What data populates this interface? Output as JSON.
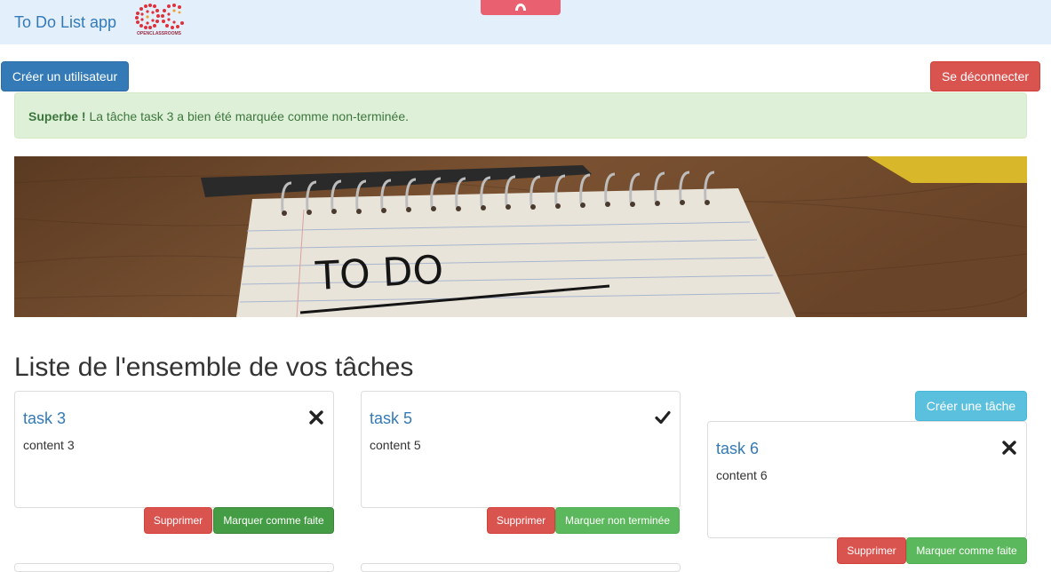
{
  "app": {
    "brand": "To Do List app",
    "logo_text": "OPENCLASSROOMS"
  },
  "toolbar": {
    "create_user": "Créer un utilisateur",
    "logout": "Se déconnecter"
  },
  "alert": {
    "strong": "Superbe !",
    "message": " La tâche task 3 a bien été marquée comme non-terminée."
  },
  "banner": {
    "text": "TO DO"
  },
  "main": {
    "heading": "Liste de l'ensemble de vos tâches",
    "create_task": "Créer une tâche"
  },
  "tasks": [
    {
      "title": "task 3",
      "content": "content 3",
      "status_icon": "cross-icon",
      "delete": "Supprimer",
      "toggle": "Marquer comme faite"
    },
    {
      "title": "task 5",
      "content": "content 5",
      "status_icon": "check-icon",
      "delete": "Supprimer",
      "toggle": "Marquer non terminée"
    },
    {
      "title": "task 6",
      "content": "content 6",
      "status_icon": "cross-icon",
      "delete": "Supprimer",
      "toggle": "Marquer comme faite"
    }
  ],
  "colors": {
    "navbar_bg": "#e3f0fc",
    "primary": "#337ab7",
    "danger": "#d9534f",
    "success": "#5cb85c",
    "info": "#5bc0de",
    "alert_bg": "#dff0d8",
    "alert_text": "#3c763d"
  }
}
